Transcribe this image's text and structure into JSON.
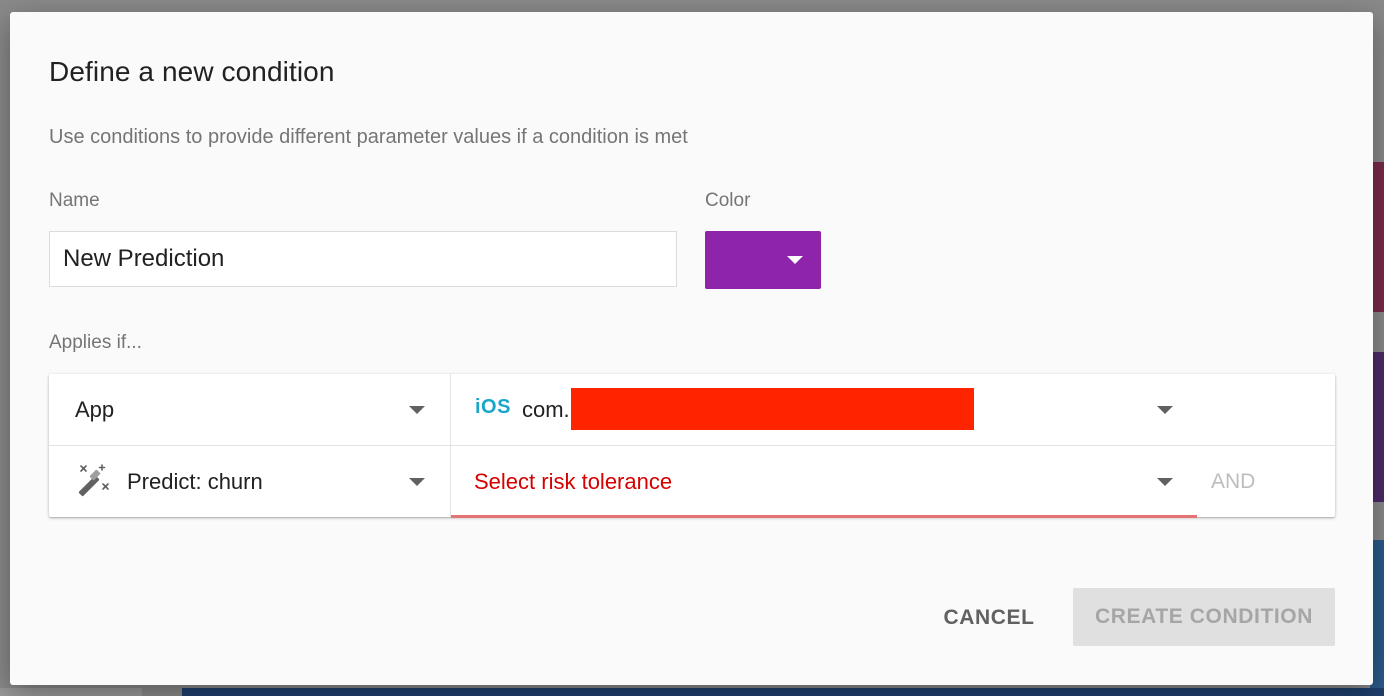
{
  "dialog": {
    "title": "Define a new condition",
    "subtitle": "Use conditions to provide different parameter values if a condition is met"
  },
  "form": {
    "name_label": "Name",
    "name_value": "New Prediction",
    "color_label": "Color",
    "color_value": "#8e24aa",
    "applies_label": "Applies if..."
  },
  "conditions": [
    {
      "type_label": "App",
      "platform_icon": "ios-icon",
      "platform_text": "iOS",
      "value_text": "com.",
      "value_redacted": true
    },
    {
      "type_label": "Predict: churn",
      "type_icon": "magic-wand-icon",
      "value_placeholder": "Select risk tolerance",
      "value_state": "error",
      "connector_label": "AND"
    }
  ],
  "actions": {
    "cancel_label": "CANCEL",
    "create_label": "CREATE CONDITION",
    "create_disabled": true
  },
  "colors": {
    "error": "#d50000",
    "error_underline": "#e57373",
    "ios_accent": "#1aa6c9",
    "redaction": "#ff2400"
  }
}
